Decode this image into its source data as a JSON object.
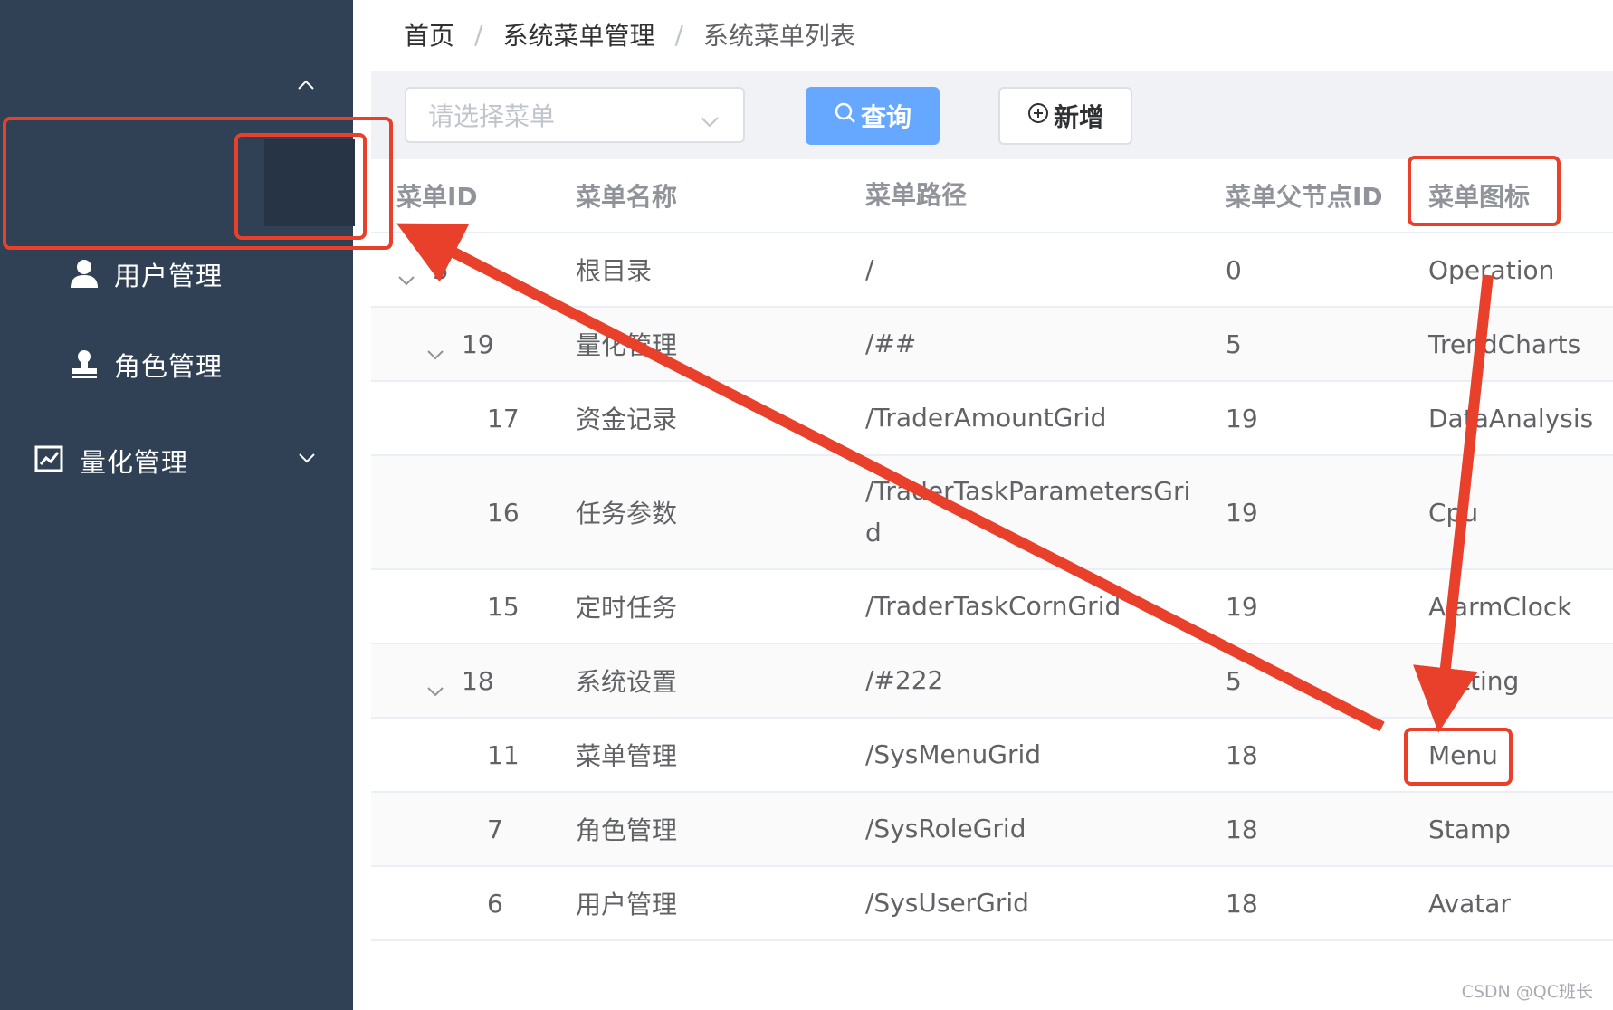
{
  "sidebar": {
    "items": [
      {
        "label": "用户管理",
        "icon": "user-icon"
      },
      {
        "label": "角色管理",
        "icon": "stamp-icon"
      },
      {
        "label": "量化管理",
        "icon": "trend-charts-icon"
      }
    ]
  },
  "breadcrumb": [
    "首页",
    "系统菜单管理",
    "系统菜单列表"
  ],
  "breadcrumb_separator": "/",
  "toolbar": {
    "select_placeholder": "请选择菜单",
    "search_label": "查询",
    "add_label": "新增"
  },
  "table": {
    "columns": [
      "菜单ID",
      "菜单名称",
      "菜单路径",
      "菜单父节点ID",
      "菜单图标"
    ],
    "rows": [
      {
        "id": "5",
        "name": "根目录",
        "path": "/",
        "parent": "0",
        "icon": "Operation"
      },
      {
        "id": "19",
        "name": "量化管理",
        "path": "/##",
        "parent": "5",
        "icon": "TrendCharts"
      },
      {
        "id": "17",
        "name": "资金记录",
        "path": "/TraderAmountGrid",
        "parent": "19",
        "icon": "DataAnalysis"
      },
      {
        "id": "16",
        "name": "任务参数",
        "path": "/TraderTaskParametersGrid",
        "parent": "19",
        "icon": "Cpu"
      },
      {
        "id": "15",
        "name": "定时任务",
        "path": "/TraderTaskCornGrid",
        "parent": "19",
        "icon": "AlarmClock"
      },
      {
        "id": "18",
        "name": "系统设置",
        "path": "/#222",
        "parent": "5",
        "icon": "Setting"
      },
      {
        "id": "11",
        "name": "菜单管理",
        "path": "/SysMenuGrid",
        "parent": "18",
        "icon": "Menu"
      },
      {
        "id": "7",
        "name": "角色管理",
        "path": "/SysRoleGrid",
        "parent": "18",
        "icon": "Stamp"
      },
      {
        "id": "6",
        "name": "用户管理",
        "path": "/SysUserGrid",
        "parent": "18",
        "icon": "Avatar"
      }
    ]
  },
  "watermark": "CSDN @QC班长",
  "colors": {
    "sidebar_bg": "#304156",
    "primary": "#66a8ff",
    "annotation_red": "#e8402a"
  }
}
